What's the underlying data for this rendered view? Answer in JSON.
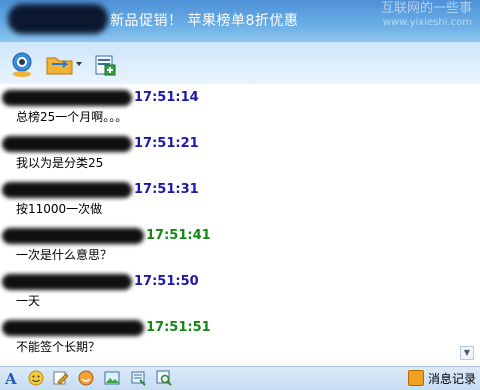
{
  "window": {
    "title": "新品促销！ 苹果榜单8折优惠",
    "watermark_line1": "互联网的一些事",
    "watermark_line2": "www.yixieshi.com"
  },
  "toolbar": {
    "icons": [
      "video-call-icon",
      "file-transfer-icon",
      "add-app-icon"
    ]
  },
  "messages": [
    {
      "time": "17:51:14",
      "text": "总榜25一个月啊。。。",
      "time_color": "blue"
    },
    {
      "time": "17:51:21",
      "text": "我以为是分类25",
      "time_color": "blue"
    },
    {
      "time": "17:51:31",
      "text": "按11000一次做",
      "time_color": "blue"
    },
    {
      "time": "17:51:41",
      "text": "一次是什么意思？",
      "time_color": "green"
    },
    {
      "time": "17:51:50",
      "text": "一天",
      "time_color": "blue"
    },
    {
      "time": "17:51:51",
      "text": "不能签个长期？",
      "time_color": "green"
    }
  ],
  "bottombar": {
    "history_label": "消息记录"
  },
  "colors": {
    "title_bar": "#5c9fe0",
    "time_blue": "#1a1aa6",
    "time_green": "#138a13"
  }
}
